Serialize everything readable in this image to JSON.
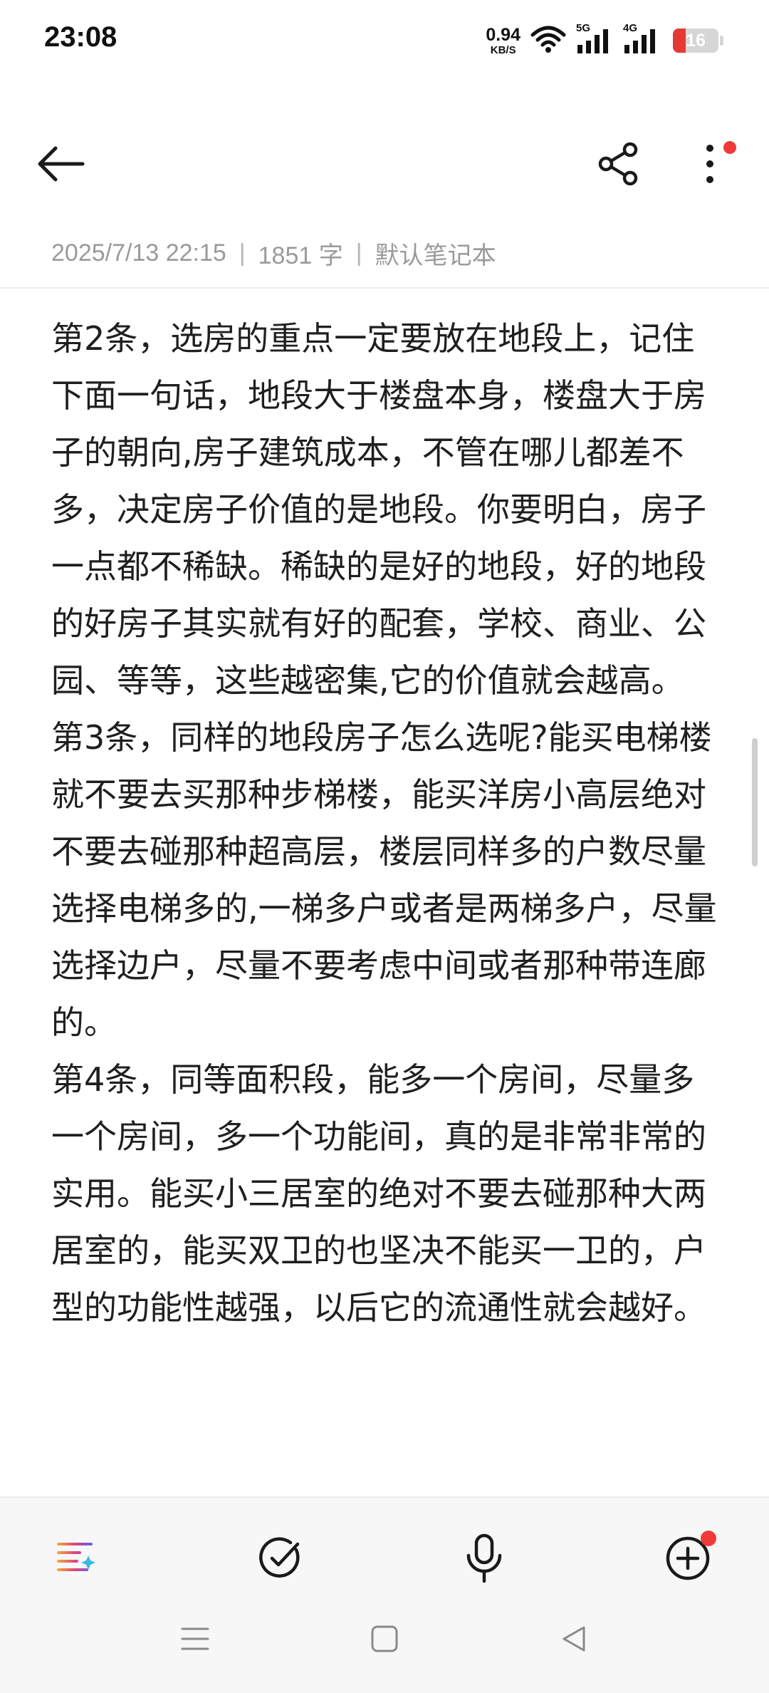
{
  "status_bar": {
    "time": "23:08",
    "net_speed_value": "0.94",
    "net_speed_unit": "KB/S",
    "sim1_label": "5G",
    "sim2_label": "4G",
    "battery_level": "16",
    "battery_fraction": 0.16,
    "battery_color": "#e53935"
  },
  "toolbar": {
    "back_icon": "arrow-left-icon",
    "share_icon": "share-icon",
    "more_icon": "more-vertical-icon",
    "notify_color": "#f03a3a"
  },
  "meta": {
    "datetime": "2025/7/13 22:15",
    "sep1": "|",
    "word_count": "1851 字",
    "sep2": "|",
    "notebook": "默认笔记本"
  },
  "content": {
    "paragraphs": [
      "第2条，选房的重点一定要放在地段上，记住下面一句话，地段大于楼盘本身，楼盘大于房子的朝向,房子建筑成本，不管在哪儿都差不多，决定房子价值的是地段。你要明白，房子一点都不稀缺。稀缺的是好的地段，好的地段的好房子其实就有好的配套，学校、商业、公园、等等，这些越密集,它的价值就会越高。",
      "第3条，同样的地段房子怎么选呢?能买电梯楼就不要去买那种步梯楼，能买洋房小高层绝对不要去碰那种超高层，楼层同样多的户数尽量选择电梯多的,一梯多户或者是两梯多户，尽量选择边户，尽量不要考虑中间或者那种带连廊的。",
      "第4条，同等面积段，能多一个房间，尽量多一个房间，多一个功能间，真的是非常非常的实用。能买小三居室的绝对不要去碰那种大两居室的，能买双卫的也坚决不能买一卫的，户型的功能性越强，以后它的流通性就会越好。"
    ]
  },
  "bottom_toolbar": {
    "tools": [
      "ai-format-icon",
      "checklist-icon",
      "microphone-icon",
      "add-icon"
    ]
  },
  "nav_bar": {
    "buttons": [
      "menu-icon",
      "home-icon",
      "back-icon"
    ]
  }
}
